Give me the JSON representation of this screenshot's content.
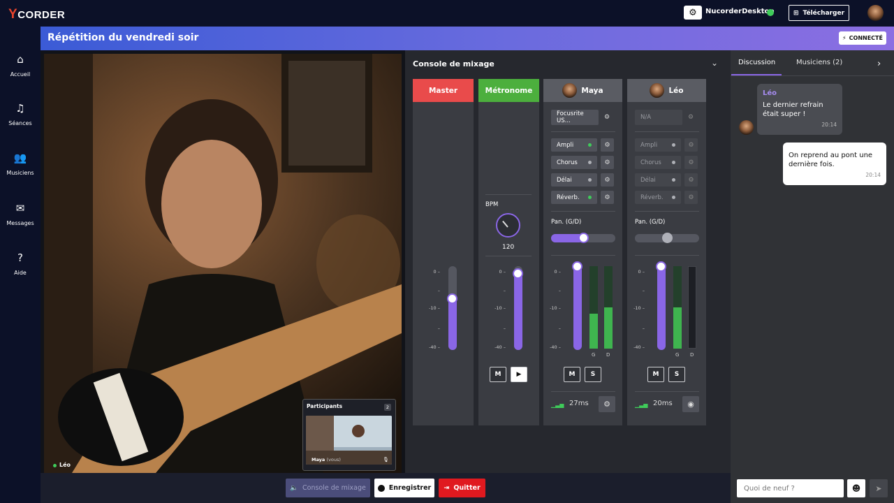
{
  "app": {
    "logo_mark": "Y",
    "logo_text": "CORDER"
  },
  "topbar": {
    "desktop_label": "NucorderDesktop",
    "download_label": "Télécharger",
    "status_color": "#3fcc5a"
  },
  "sidebar": {
    "items": [
      {
        "label": "Accueil",
        "icon": "home-icon"
      },
      {
        "label": "Séances",
        "icon": "music-note-icon"
      },
      {
        "label": "Musiciens",
        "icon": "users-icon"
      },
      {
        "label": "Messages",
        "icon": "envelope-icon"
      },
      {
        "label": "Aide",
        "icon": "help-icon"
      }
    ]
  },
  "session": {
    "title": "Répétition du vendredi soir",
    "connection_status": "CONNECTÉ"
  },
  "video": {
    "main_name": "Léo",
    "participants_label": "Participants",
    "participants_count": "2",
    "self_name": "Maya",
    "self_suffix": "(vous)"
  },
  "console": {
    "title": "Console de mixage",
    "scale": [
      "0 –",
      "–",
      "-10 –",
      "–",
      "-40 –"
    ],
    "master": {
      "label": "Master",
      "color": "#e94b4b",
      "level": 0.62
    },
    "metronome": {
      "label": "Métronome",
      "color": "#4caf3d",
      "bpm_label": "BPM",
      "bpm_value": "120",
      "level": 0.92,
      "mute": "M",
      "play_icon": "play-icon"
    },
    "channels": [
      {
        "name": "Maya",
        "device": "Focusrite US...",
        "effects": [
          {
            "label": "Ampli",
            "on": true
          },
          {
            "label": "Chorus",
            "on": false
          },
          {
            "label": "Délai",
            "on": false
          },
          {
            "label": "Réverb.",
            "on": true
          }
        ],
        "pan_label": "Pan. (G/D)",
        "pan": 0.5,
        "level": 1.0,
        "meter_left": 0.42,
        "meter_right": 0.5,
        "meter_left_label": "G",
        "meter_right_label": "D",
        "mute": "M",
        "solo": "S",
        "latency": "27ms",
        "action_icon": "gear-icon"
      },
      {
        "name": "Léo",
        "device": "N/A",
        "effects": [
          {
            "label": "Ampli",
            "on": false
          },
          {
            "label": "Chorus",
            "on": false
          },
          {
            "label": "Délai",
            "on": false
          },
          {
            "label": "Réverb.",
            "on": false
          }
        ],
        "pan_label": "Pan. (G/D)",
        "pan": 0.5,
        "level": 1.0,
        "meter_left": 0.5,
        "meter_right": 0.0,
        "meter_left_label": "G",
        "meter_right_label": "D",
        "mute": "M",
        "solo": "S",
        "latency": "20ms",
        "action_icon": "eye-icon"
      }
    ]
  },
  "chat": {
    "tabs": [
      {
        "label": "Discussion",
        "active": true
      },
      {
        "label": "Musiciens (2)",
        "active": false
      }
    ],
    "messages": [
      {
        "author": "Léo",
        "text": "Le dernier refrain était super !",
        "time": "20:14",
        "mine": false
      },
      {
        "author": "",
        "text": "On reprend au pont une dernière fois.",
        "time": "20:14",
        "mine": true
      }
    ],
    "input_placeholder": "Quoi de neuf ?"
  },
  "controls": {
    "mixer": "Console de mixage",
    "record": "Enregistrer",
    "quit": "Quitter"
  }
}
